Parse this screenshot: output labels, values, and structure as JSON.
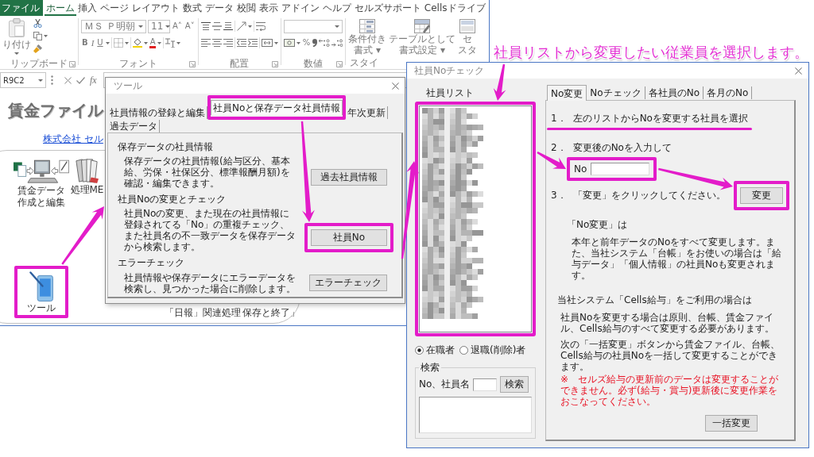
{
  "excel": {
    "ribbon_tabs": [
      {
        "label": "ファイル",
        "kind": "file",
        "selected": false
      },
      {
        "label": "ホーム",
        "kind": "tab",
        "selected": true
      },
      {
        "label": "挿入",
        "kind": "tab",
        "selected": false
      },
      {
        "label": "ページ レイアウト",
        "kind": "tab",
        "selected": false
      },
      {
        "label": "数式",
        "kind": "tab",
        "selected": false
      },
      {
        "label": "データ",
        "kind": "tab",
        "selected": false
      },
      {
        "label": "校閲",
        "kind": "tab",
        "selected": false
      },
      {
        "label": "表示",
        "kind": "tab",
        "selected": false
      },
      {
        "label": "アドイン",
        "kind": "tab",
        "selected": false
      },
      {
        "label": "ヘルプ",
        "kind": "tab",
        "selected": false
      },
      {
        "label": "セルズサポート",
        "kind": "tab",
        "selected": false
      },
      {
        "label": "Cellsドライブ",
        "kind": "tab",
        "selected": false
      }
    ],
    "ribbon": {
      "disabled": true,
      "clipboard": {
        "paste_label": "り付け",
        "group_label": "リップボード"
      },
      "font": {
        "font_name": "ＭＳ Ｐ明朝",
        "font_size": "11",
        "size_buttons": [
          "A˄",
          "A˅"
        ],
        "style_buttons": [
          "B",
          "I",
          "U"
        ],
        "color_button": "A",
        "group_label": "フォント"
      },
      "alignment": {
        "group_label": "配置"
      },
      "number": {
        "percent_button": "%",
        "group_label": "数値"
      },
      "styles": {
        "buttons": [
          {
            "lines": [
              "条件付き",
              "書式 ▾"
            ]
          },
          {
            "lines": [
              "テーブルとして",
              "書式設定 ▾"
            ]
          },
          {
            "lines": [
              "セ",
              "スタ"
            ]
          }
        ],
        "group_label": "スタイ"
      }
    },
    "formula_bar": {
      "name_box": "R9C2",
      "function_button": "fx"
    },
    "sheet": {
      "title": "賃金ファイル",
      "company_link": "株式会社 セル",
      "menu_items": [
        {
          "kind": "computer",
          "lines": [
            "賃金データ",
            "作成と編集"
          ],
          "highlighted": false
        },
        {
          "kind": "books",
          "lines": [
            "処理ME"
          ],
          "highlighted": false
        },
        {
          "kind": "tablet",
          "lines": [
            "ツール"
          ],
          "highlighted": true
        },
        {
          "kind": "label",
          "lines": [
            "「日報」関連処理"
          ],
          "highlighted": false
        },
        {
          "kind": "label",
          "lines": [
            "保存と終了」"
          ],
          "highlighted": false
        }
      ]
    }
  },
  "tool_dialog": {
    "title": "ツール",
    "tabs": [
      {
        "label": "社員情報の登録と編集",
        "selected": false,
        "highlighted": false
      },
      {
        "label": "社員Noと保存データ社員情報",
        "selected": true,
        "highlighted": true
      },
      {
        "label": "年次更新",
        "selected": false,
        "highlighted": false
      },
      {
        "label": "過去データ",
        "selected": false,
        "highlighted": false
      }
    ],
    "sections": [
      {
        "heading": "保存データの社員情報",
        "text": "保存データの社員情報(給与区分、基本給、労保・社保区分、標準報酬月額)を確認・編集できます。",
        "button": "過去社員情報",
        "highlighted": false
      },
      {
        "heading": "社員Noの変更とチェック",
        "text": "社員Noの変更、また現在の社員情報に登録されてる「No」の重複チェック、また社員名の不一致データを保存データから検索します。",
        "button": "社員No",
        "highlighted": true
      },
      {
        "heading": "エラーチェック",
        "text": "社員情報や保存データにエラーデータを検索し、見つかった場合に削除します。",
        "button": "エラーチェック",
        "highlighted": false
      }
    ]
  },
  "callout": "社員リストから変更したい従業員を選択します。",
  "no_check_dialog": {
    "title": "社員Noチェック",
    "list_label": "社員リスト",
    "list_highlighted": true,
    "filters": [
      {
        "label": "在職者",
        "selected": true
      },
      {
        "label": "退職(削除)者",
        "selected": false
      }
    ],
    "search": {
      "legend": "検索",
      "field_label": "No、社員名",
      "button": "検索"
    },
    "tabs": [
      {
        "label": "No変更",
        "selected": true
      },
      {
        "label": "Noチェック",
        "selected": false
      },
      {
        "label": "各社員のNo",
        "selected": false
      },
      {
        "label": "各月のNo",
        "selected": false
      }
    ],
    "steps": [
      {
        "number": "1．",
        "text": "左のリストからNoを変更する社員を選択",
        "underlined": true
      },
      {
        "number": "2．",
        "text": "変更後のNoを入力して",
        "underlined": false,
        "field": {
          "label": "No",
          "highlighted": true
        }
      },
      {
        "number": "3．",
        "text": "「変更」をクリックしてください。",
        "underlined": false,
        "button": {
          "label": "変更",
          "highlighted": true
        }
      }
    ],
    "note_heading": "「No変更」は",
    "note": "本年と前年データのNoをすべて変更します。また、当社システム「台帳」をお使いの場合は「給与データ」「個人情報」の社員Noも変更されます。",
    "cells_heading": "当社システム「Cells給与」をご利用の場合は",
    "cells_notes": [
      {
        "kind": "normal",
        "text": "社員Noを変更する場合は原則、台帳、賃金ファイル、Cells給与のすべて変更する必要があります。"
      },
      {
        "kind": "normal",
        "text": "次の「一括変更」ボタンから賃金ファイル、台帳、Cells給与の社員Noを一括して変更することができます。"
      },
      {
        "kind": "warning",
        "text": "※　セルズ給与の更新前のデータは変更することができません。必ず(給与・賞与)更新後に変更作業をおこなってください。"
      }
    ],
    "bulk_button": "一括変更"
  }
}
